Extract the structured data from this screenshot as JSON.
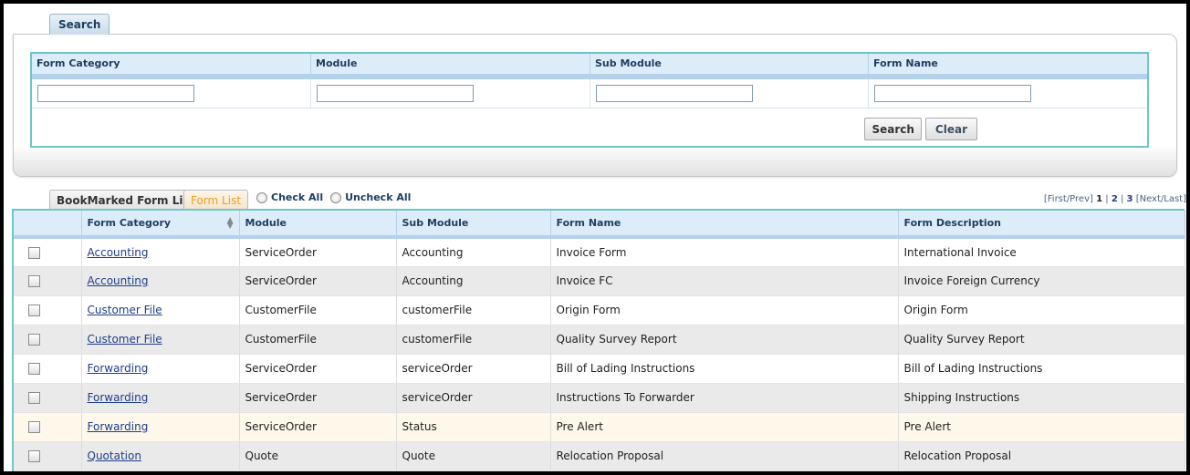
{
  "search": {
    "tab_label": "Search",
    "columns": [
      "Form Category",
      "Module",
      "Sub Module",
      "Form Name"
    ],
    "values": [
      "",
      "",
      "",
      ""
    ],
    "search_button": "Search",
    "clear_button": "Clear"
  },
  "tabs": {
    "bookmarked": "BookMarked Form List",
    "form_list": "Form List"
  },
  "check_all": "Check All",
  "uncheck_all": "Uncheck All",
  "pager": {
    "first_prev": "[First/Prev]",
    "current": "1",
    "page2": "2",
    "page3": "3",
    "next_last": "[Next/Last]"
  },
  "grid": {
    "headers": [
      "Form Category",
      "Module",
      "Sub Module",
      "Form Name",
      "Form Description"
    ],
    "rows": [
      {
        "category": "Accounting",
        "module": "ServiceOrder",
        "submodule": "Accounting",
        "name": "Invoice Form",
        "description": "International Invoice"
      },
      {
        "category": "Accounting",
        "module": "ServiceOrder",
        "submodule": "Accounting",
        "name": "Invoice FC",
        "description": "Invoice Foreign Currency"
      },
      {
        "category": "Customer File",
        "module": "CustomerFile",
        "submodule": "customerFile",
        "name": "Origin Form",
        "description": "Origin Form"
      },
      {
        "category": "Customer File",
        "module": "CustomerFile",
        "submodule": "customerFile",
        "name": "Quality Survey Report",
        "description": "Quality Survey Report"
      },
      {
        "category": "Forwarding",
        "module": "ServiceOrder",
        "submodule": "serviceOrder",
        "name": "Bill of Lading Instructions",
        "description": "Bill of Lading Instructions"
      },
      {
        "category": "Forwarding",
        "module": "ServiceOrder",
        "submodule": "serviceOrder",
        "name": "Instructions To Forwarder",
        "description": "Shipping Instructions"
      },
      {
        "category": "Forwarding",
        "module": "ServiceOrder",
        "submodule": "Status",
        "name": "Pre Alert",
        "description": "Pre Alert"
      },
      {
        "category": "Quotation",
        "module": "Quote",
        "submodule": "Quote",
        "name": "Relocation Proposal",
        "description": "Relocation Proposal"
      }
    ]
  }
}
